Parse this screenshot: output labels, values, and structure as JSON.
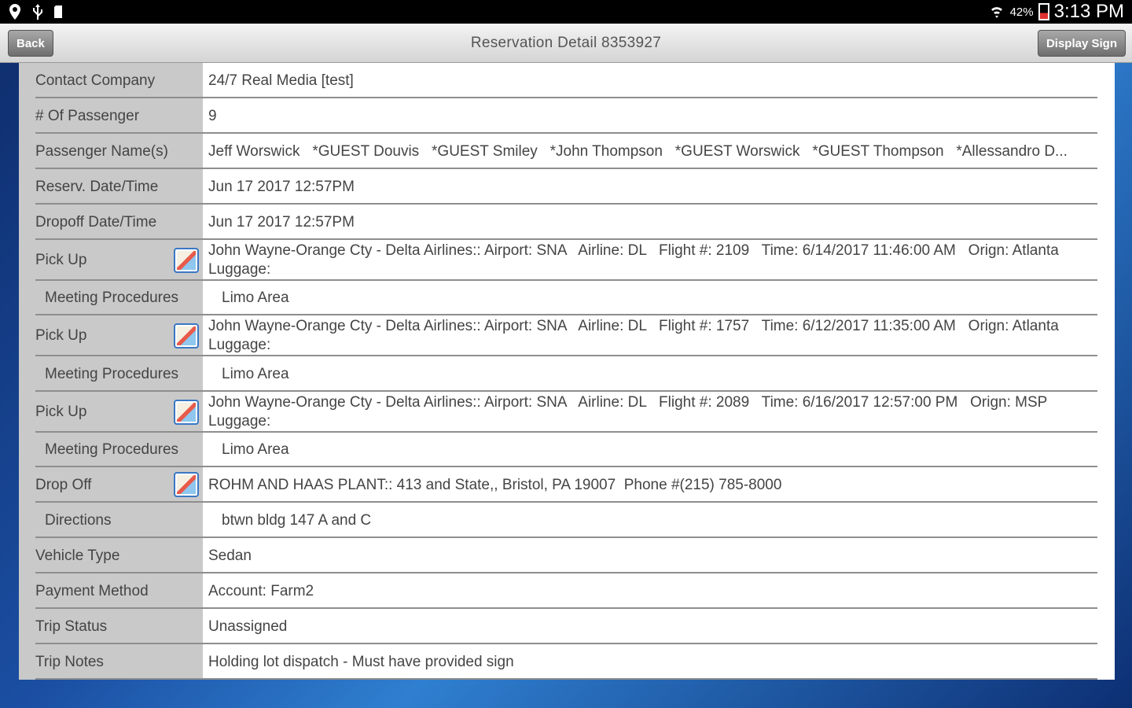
{
  "status_bar": {
    "battery_percent": "42%",
    "time": "3:13 PM"
  },
  "header": {
    "back_label": "Back",
    "title": "Reservation Detail 8353927",
    "display_sign_label": "Display Sign"
  },
  "rows": [
    {
      "label": "Contact Company",
      "value": "24/7 Real Media [test]"
    },
    {
      "label": "# Of Passenger",
      "value": "9"
    },
    {
      "label": "Passenger Name(s)",
      "value": "Jeff Worswick   *GUEST Douvis   *GUEST Smiley   *John Thompson   *GUEST Worswick   *GUEST Thompson   *Allessandro D..."
    },
    {
      "label": "Reserv. Date/Time",
      "value": "Jun 17 2017 12:57PM"
    },
    {
      "label": "Dropoff Date/Time",
      "value": "Jun 17 2017 12:57PM"
    },
    {
      "label": "Pick Up",
      "value": "John Wayne-Orange Cty - Delta Airlines:: Airport: SNA   Airline: DL   Flight #: 2109   Time: 6/14/2017 11:46:00 AM   Orign: Atlanta",
      "value2": "Luggage:"
    },
    {
      "label": "Meeting Procedures",
      "value": "Limo Area"
    },
    {
      "label": "Pick Up",
      "value": "John Wayne-Orange Cty - Delta Airlines:: Airport: SNA   Airline: DL   Flight #: 1757   Time: 6/12/2017 11:35:00 AM   Orign: Atlanta",
      "value2": "Luggage:"
    },
    {
      "label": "Meeting Procedures",
      "value": "Limo Area"
    },
    {
      "label": "Pick Up",
      "value": "John Wayne-Orange Cty - Delta Airlines:: Airport: SNA   Airline: DL   Flight #: 2089   Time: 6/16/2017 12:57:00 PM   Orign: MSP",
      "value2": "Luggage:"
    },
    {
      "label": "Meeting Procedures",
      "value": "Limo Area"
    },
    {
      "label": "Drop Off",
      "value": "ROHM AND HAAS PLANT:: 413 and State,, Bristol, PA 19007  Phone #(215) 785-8000"
    },
    {
      "label": "Directions",
      "value": "btwn bldg 147 A and C"
    },
    {
      "label": "Vehicle Type",
      "value": "Sedan"
    },
    {
      "label": "Payment Method",
      "value": "Account: Farm2"
    },
    {
      "label": "Trip Status",
      "value": "Unassigned"
    },
    {
      "label": "Trip Notes",
      "value": "Holding lot dispatch - Must have provided sign"
    }
  ]
}
